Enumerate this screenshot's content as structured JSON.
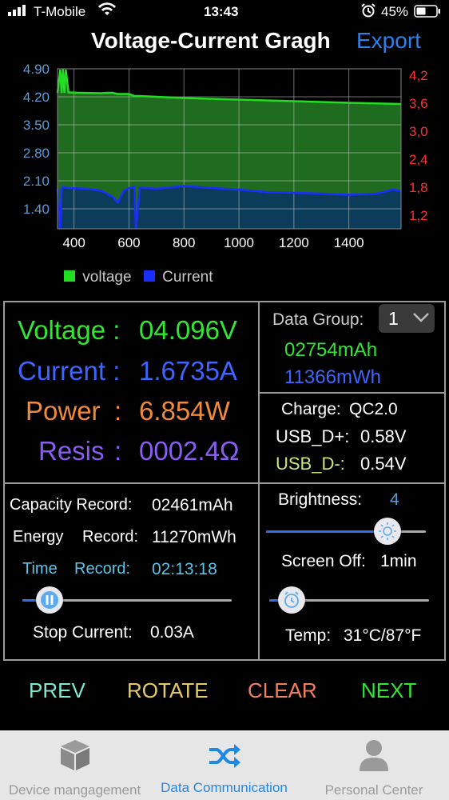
{
  "status": {
    "carrier": "T-Mobile",
    "time": "13:43",
    "battery": "45%"
  },
  "header": {
    "title": "Voltage-Current Gragh",
    "export_label": "Export"
  },
  "chart_data": {
    "type": "line",
    "x_ticks": [
      "400",
      "800",
      "1000",
      "1200",
      "1400"
    ],
    "x_tick_values": [
      400,
      800,
      1000,
      1200,
      1400
    ],
    "x_tick_extra": "600",
    "xlim": [
      340,
      1590
    ],
    "y_left_ticks": [
      "4.90",
      "4.20",
      "3.50",
      "2.80",
      "2.10",
      "1.40"
    ],
    "y_right_ticks": [
      "4,2",
      "3,6",
      "3,0",
      "2,4",
      "1,8",
      "1,2"
    ],
    "y_left_lim": [
      0.9,
      4.9
    ],
    "legend_position": "bottom-left",
    "series": [
      {
        "name": "voltage",
        "color": "#22dd22",
        "x": [
          340,
          350,
          355,
          360,
          365,
          370,
          380,
          420,
          500,
          520,
          540,
          560,
          600,
          620,
          640,
          700,
          800,
          1000,
          1200,
          1400,
          1590
        ],
        "y": [
          4.3,
          4.88,
          4.3,
          4.9,
          4.3,
          4.88,
          4.31,
          4.3,
          4.29,
          4.3,
          4.3,
          4.27,
          4.27,
          4.22,
          4.22,
          4.2,
          4.17,
          4.13,
          4.09,
          4.05,
          4.02
        ]
      },
      {
        "name": "Current",
        "color": "#1a2eff",
        "x": [
          340,
          350,
          355,
          360,
          380,
          450,
          500,
          540,
          560,
          580,
          600,
          620,
          625,
          640,
          700,
          800,
          900,
          1000,
          1100,
          1200,
          1300,
          1400,
          1500,
          1560,
          1590
        ],
        "y": [
          1.9,
          0.9,
          1.9,
          1.95,
          1.92,
          1.9,
          1.85,
          1.7,
          1.55,
          1.85,
          1.92,
          1.95,
          0.9,
          1.93,
          1.9,
          1.97,
          1.92,
          1.88,
          1.82,
          1.8,
          1.78,
          1.75,
          1.78,
          1.88,
          1.85
        ]
      }
    ]
  },
  "readings": {
    "voltage_label": "Voltage :",
    "voltage_value": "04.096V",
    "current_label": "Current :",
    "current_value": "1.6735A",
    "power_label": "Power",
    "power_colon": ":",
    "power_value": "6.854W",
    "resis_label": "Resis",
    "resis_colon": ":",
    "resis_value": "0002.4Ω"
  },
  "data_group": {
    "label": "Data Group:",
    "selected": "1",
    "mah": "02754mAh",
    "mwh": "11366mWh"
  },
  "charge": {
    "protocol_label": "Charge:",
    "protocol_value": "QC2.0",
    "dplus_label": "USB_D+:",
    "dplus_value": "0.58V",
    "dminus_label": "USB_D-:",
    "dminus_value": "0.54V"
  },
  "records": {
    "capacity_label": "Capacity Record:",
    "capacity_value": "02461mAh",
    "energy_label_1": "Energy",
    "energy_label_2": "Record:",
    "energy_value": "11270mWh",
    "time_label_1": "Time",
    "time_label_2": "Record:",
    "time_value": "02:13:18",
    "stop_label": "Stop Current:",
    "stop_value": "0.03A",
    "stop_slider_fraction": 0.13
  },
  "settings": {
    "brightness_label": "Brightness:",
    "brightness_value": "4",
    "brightness_fraction": 0.76,
    "screen_off_label": "Screen Off:",
    "screen_off_value": "1min",
    "screen_off_fraction": 0.14,
    "temp_label": "Temp:",
    "temp_value": "31°C/87°F"
  },
  "buttons": {
    "prev": "PREV",
    "rotate": "ROTATE",
    "clear": "CLEAR",
    "next": "NEXT"
  },
  "tabs": [
    {
      "label": "Device mangagement",
      "icon": "box-icon",
      "active": false
    },
    {
      "label": "Data Communication",
      "icon": "shuffle-icon",
      "active": true
    },
    {
      "label": "Personal Center",
      "icon": "person-icon",
      "active": false
    }
  ],
  "colors": {
    "green": "#33e633",
    "blue": "#3d66ff",
    "orange": "#f08a3c",
    "purple": "#8a5cf0",
    "axis_left": "#5b9bd5",
    "axis_right": "#ff3030",
    "active_tab": "#1e88e5"
  }
}
